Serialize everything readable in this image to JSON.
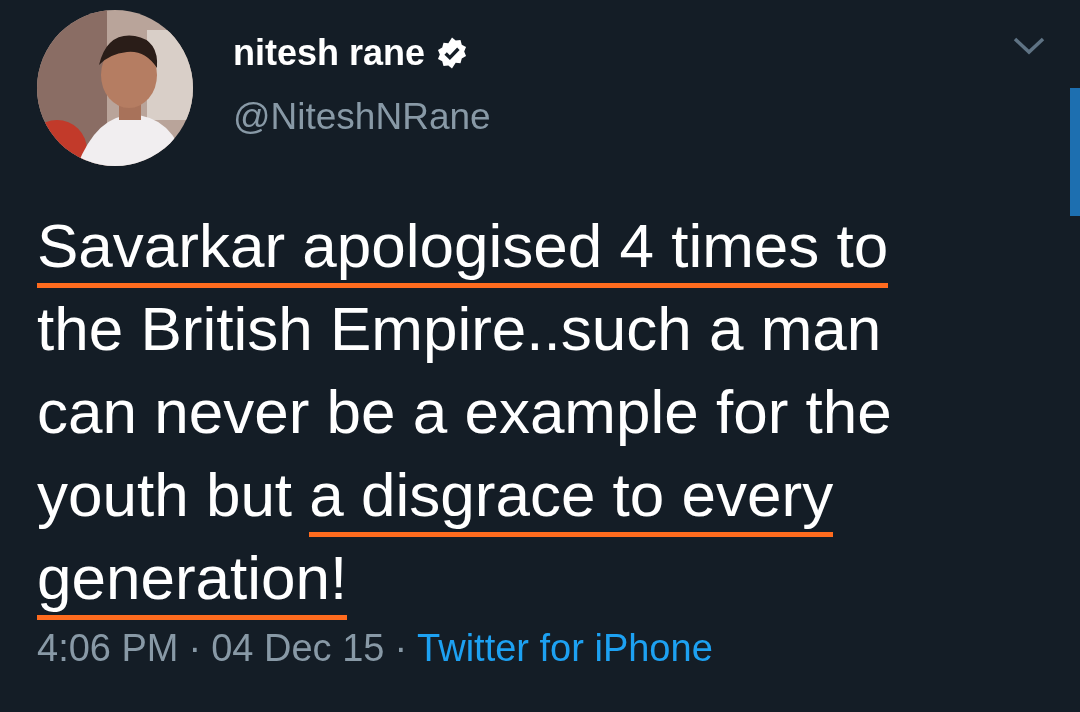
{
  "author": {
    "name": "nitesh rane",
    "verified": true,
    "handle": "@NiteshNRane"
  },
  "tweet": {
    "segments": [
      {
        "text": "Savarkar apologised 4 times to",
        "highlighted": true
      },
      {
        "text": " the British Empire..such a man can never be a example for the youth but ",
        "highlighted": false
      },
      {
        "text": "a disgrace to every generation!",
        "highlighted": true
      }
    ]
  },
  "meta": {
    "time": "4:06 PM",
    "separator_1": "·",
    "date": "04 Dec 15",
    "separator_2": "·",
    "source": "Twitter for iPhone"
  }
}
